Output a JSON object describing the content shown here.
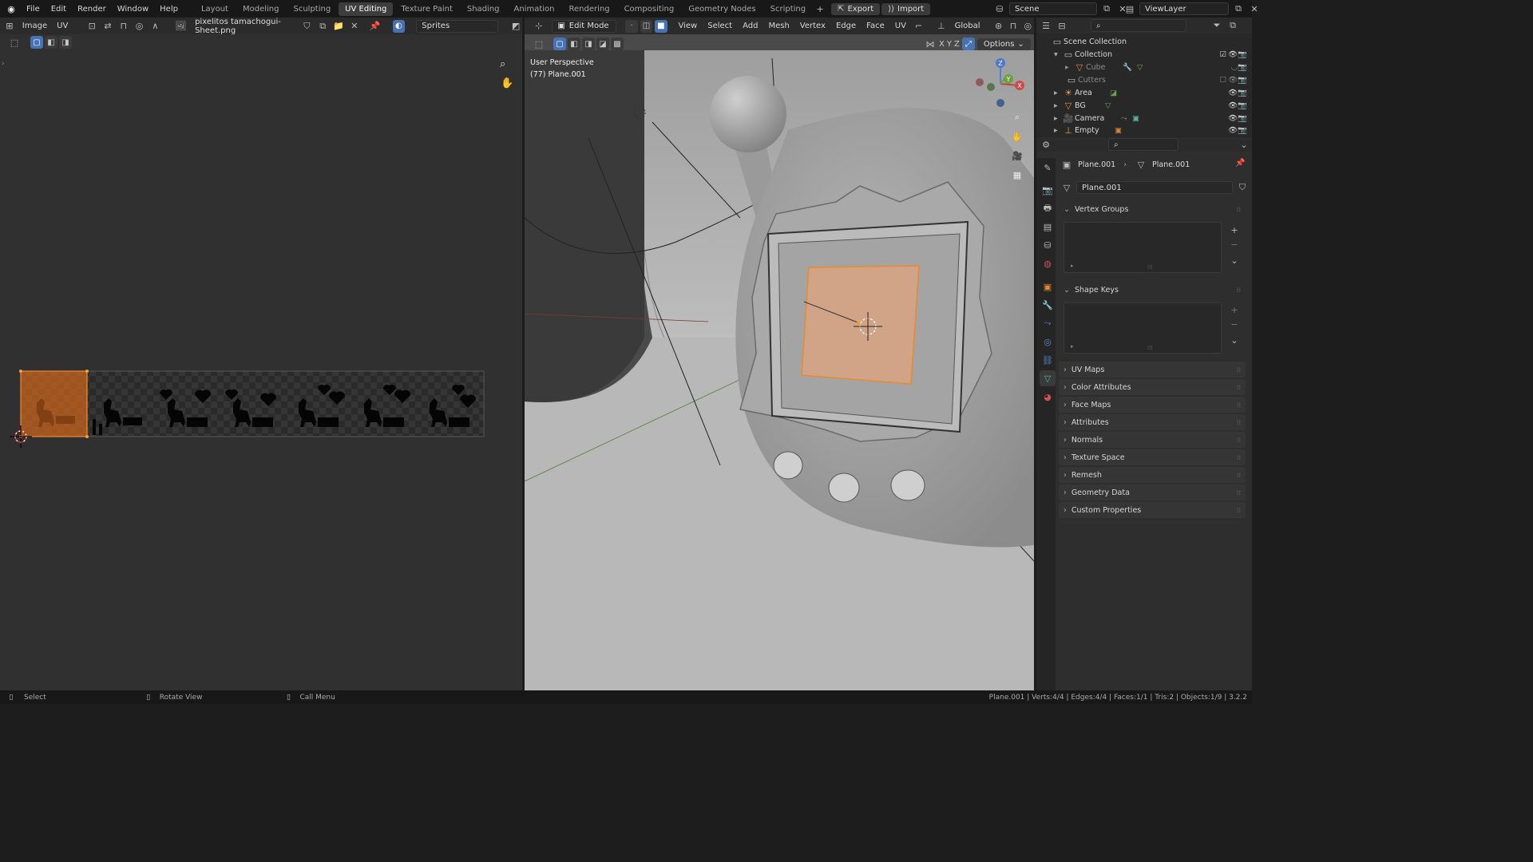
{
  "menubar": {
    "items": [
      "File",
      "Edit",
      "Render",
      "Window",
      "Help"
    ],
    "workspaces": [
      "Layout",
      "Modeling",
      "Sculpting",
      "UV Editing",
      "Texture Paint",
      "Shading",
      "Animation",
      "Rendering",
      "Compositing",
      "Geometry Nodes",
      "Scripting"
    ],
    "active_workspace": "UV Editing",
    "export_label": "Export",
    "import_label": "Import",
    "scene_name": "Scene",
    "viewlayer_name": "ViewLayer"
  },
  "uv_editor": {
    "menu_image": "Image",
    "menu_uv": "UV",
    "image_name": "pixelitos tamachogui-Sheet.png",
    "uv_map_name": "Sprites"
  },
  "viewport": {
    "mode": "Edit Mode",
    "menus": [
      "View",
      "Select",
      "Add",
      "Mesh",
      "Vertex",
      "Edge",
      "Face",
      "UV"
    ],
    "orientation": "Global",
    "axes": [
      "X",
      "Y",
      "Z"
    ],
    "options_label": "Options",
    "overlay_title": "User Perspective",
    "overlay_object": "(77) Plane.001",
    "gizmo_axes": {
      "x": "X",
      "y": "Y",
      "z": "Z"
    }
  },
  "outliner": {
    "scene_collection": "Scene Collection",
    "items": [
      {
        "name": "Collection",
        "level": 1
      },
      {
        "name": "Cube",
        "level": 2
      },
      {
        "name": "Cutters",
        "level": 1
      },
      {
        "name": "Area",
        "level": 1
      },
      {
        "name": "BG",
        "level": 1
      },
      {
        "name": "Camera",
        "level": 1
      },
      {
        "name": "Empty",
        "level": 1
      }
    ]
  },
  "properties": {
    "breadcrumb_object": "Plane.001",
    "breadcrumb_data": "Plane.001",
    "mesh_name": "Plane.001",
    "open_panels": [
      "Vertex Groups",
      "Shape Keys"
    ],
    "collapsed_panels": [
      "UV Maps",
      "Color Attributes",
      "Face Maps",
      "Attributes",
      "Normals",
      "Texture Space",
      "Remesh",
      "Geometry Data",
      "Custom Properties"
    ]
  },
  "statusbar": {
    "select": "Select",
    "rotate": "Rotate View",
    "call_menu": "Call Menu",
    "stats": "Plane.001 | Verts:4/4 | Edges:4/4 | Faces:1/1 | Tris:2 | Objects:1/9 | 3.2.2"
  },
  "colors": {
    "accent": "#4772b3",
    "selection_orange": "#e88a2f",
    "background": "#1d1d1d"
  }
}
